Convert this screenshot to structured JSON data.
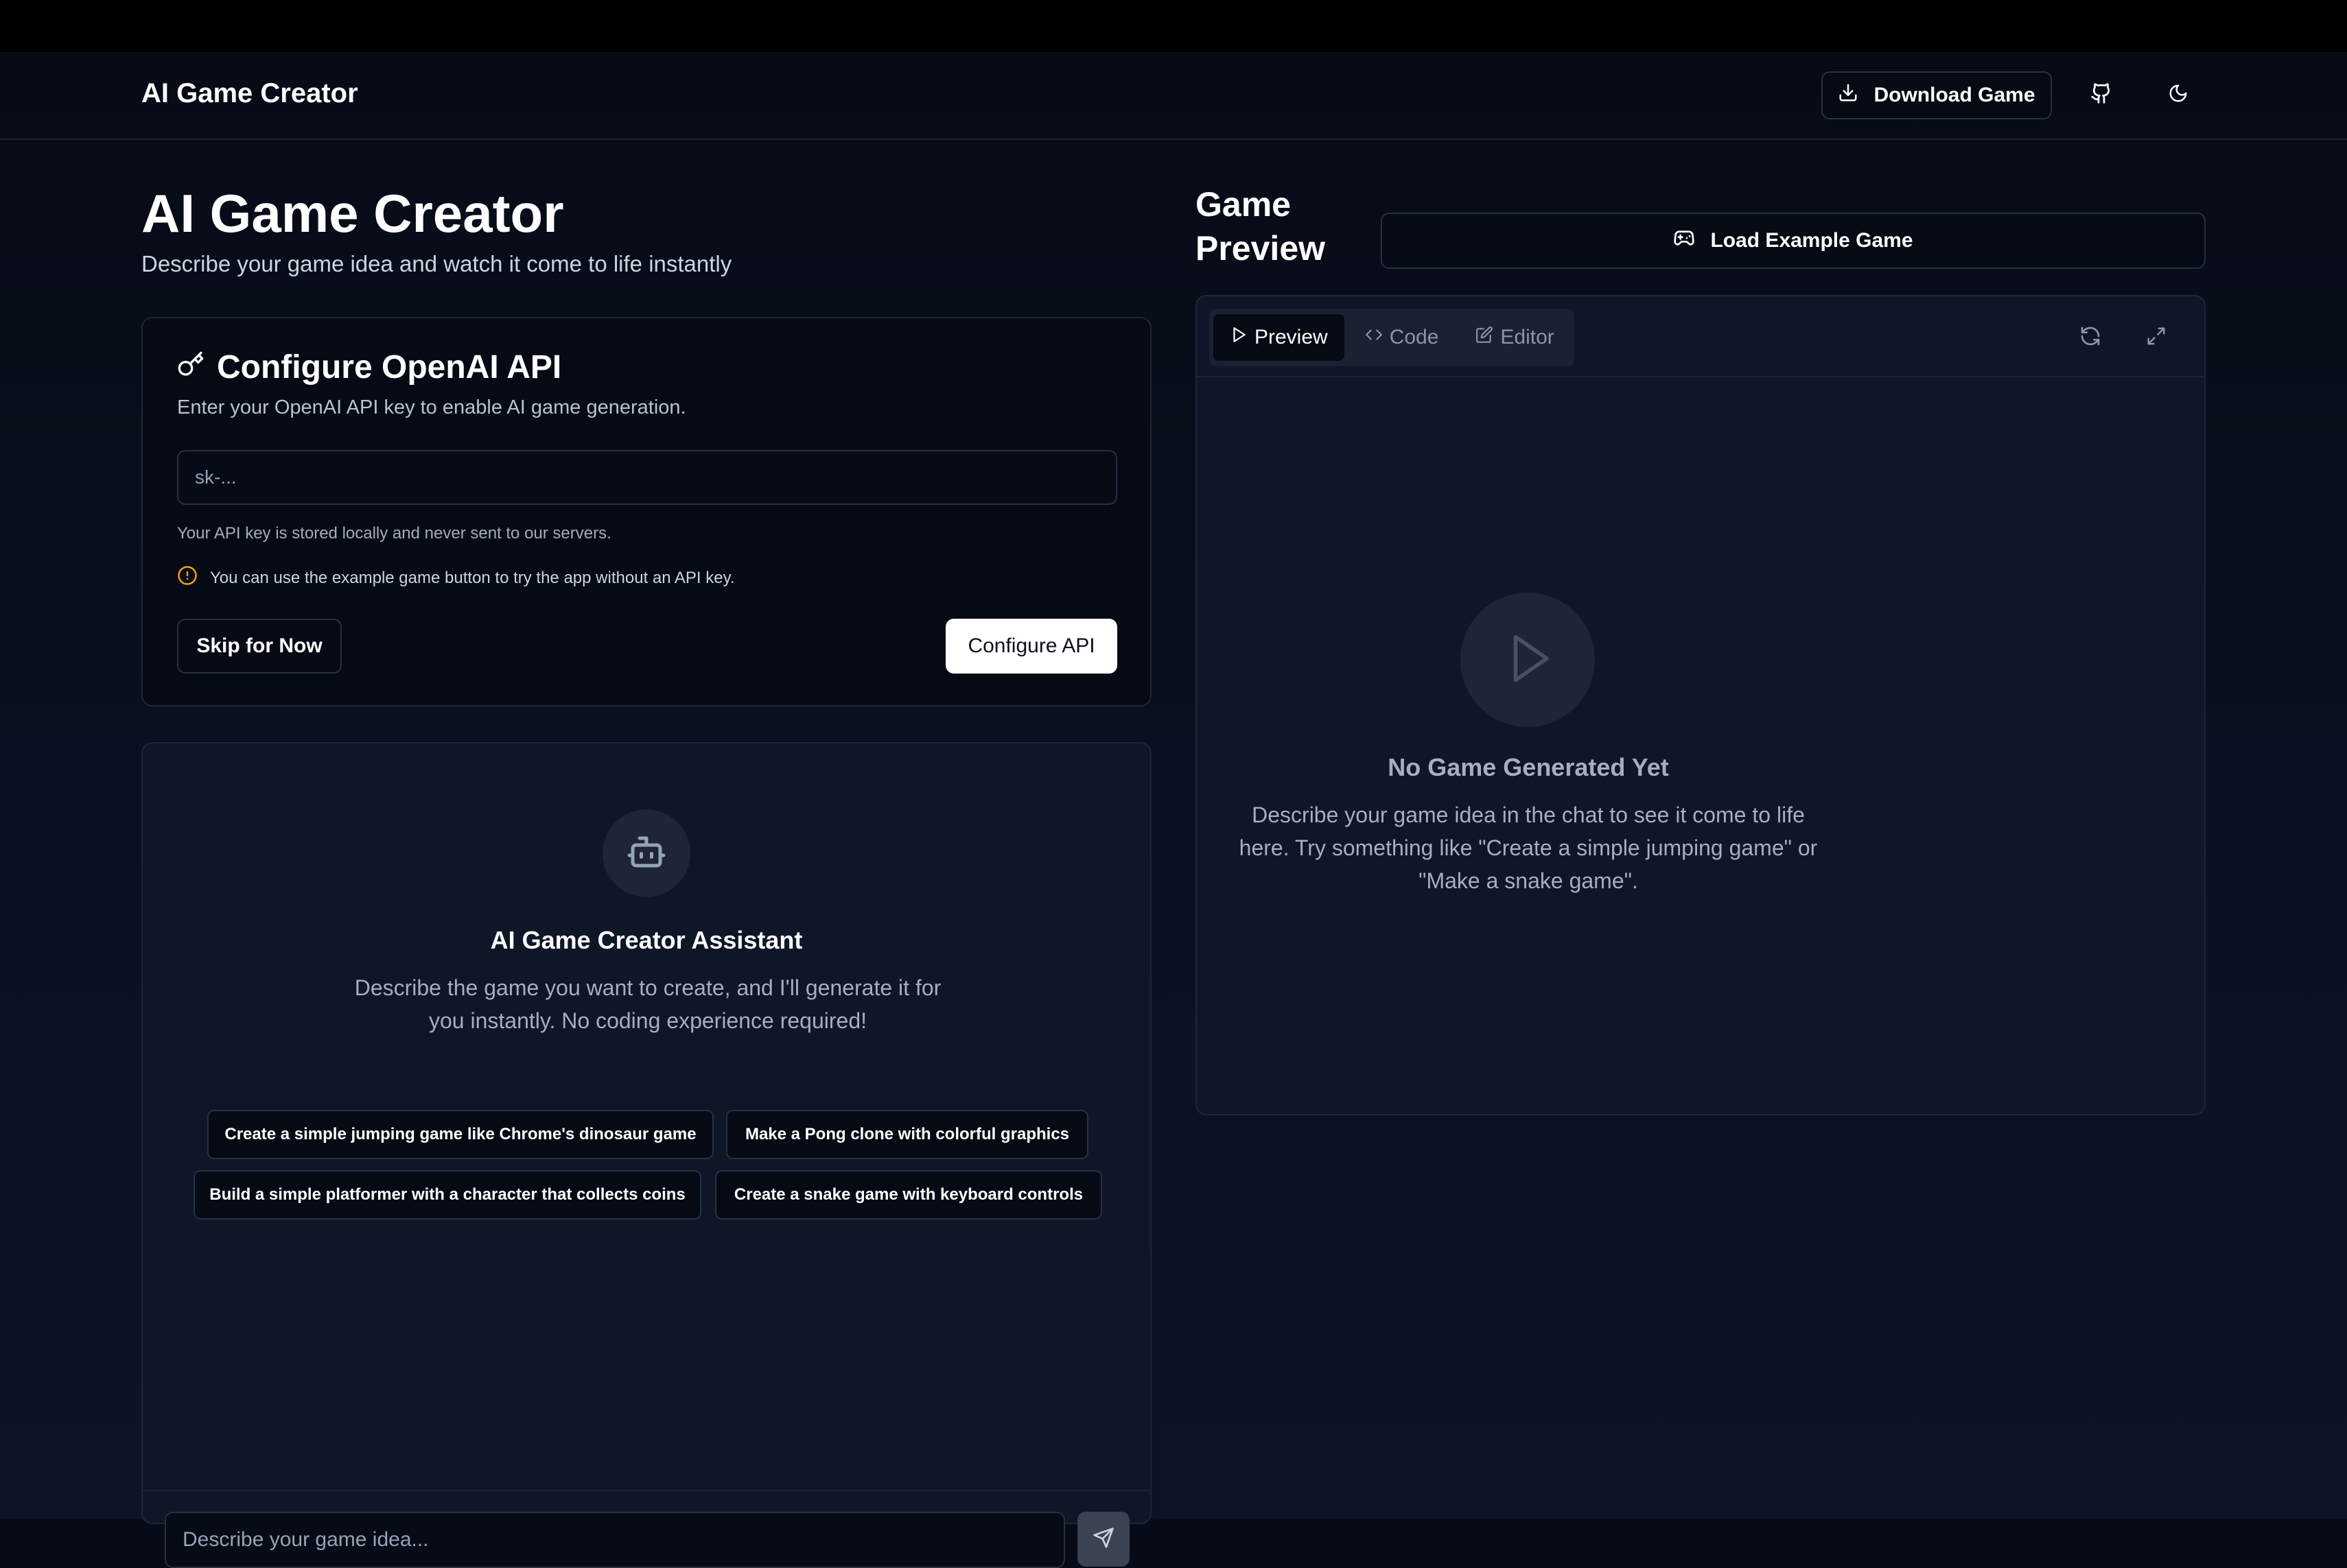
{
  "header": {
    "brand": "AI Game Creator",
    "download_label": "Download Game",
    "github_icon": "github-icon",
    "theme_icon": "moon-icon"
  },
  "hero": {
    "title": "AI Game Creator",
    "subtitle": "Describe your game idea and watch it come to life instantly"
  },
  "api": {
    "title": "Configure OpenAI API",
    "description": "Enter your OpenAI API key to enable AI game generation.",
    "input_placeholder": "sk-...",
    "note": "Your API key is stored locally and never sent to our servers.",
    "warning": "You can use the example game button to try the app without an API key.",
    "skip_label": "Skip for Now",
    "configure_label": "Configure API",
    "warning_color": "#f59e0b"
  },
  "assistant": {
    "title": "AI Game Creator Assistant",
    "description": "Describe the game you want to create, and I'll generate it for you instantly. No coding experience required!",
    "suggestions": [
      "Create a simple jumping game like Chrome's dinosaur game",
      "Make a Pong clone with colorful graphics",
      "Build a simple platformer with a character that collects coins",
      "Create a snake game with keyboard controls"
    ],
    "input_placeholder": "Describe your game idea..."
  },
  "preview": {
    "heading": "Game Preview",
    "load_label": "Load Example Game",
    "tabs": [
      "Preview",
      "Code",
      "Editor"
    ],
    "active_tab": "Preview",
    "empty_title": "No Game Generated Yet",
    "empty_description": "Describe your game idea in the chat to see it come to life here. Try something like \"Create a simple jumping game\" or \"Make a snake game\"."
  }
}
